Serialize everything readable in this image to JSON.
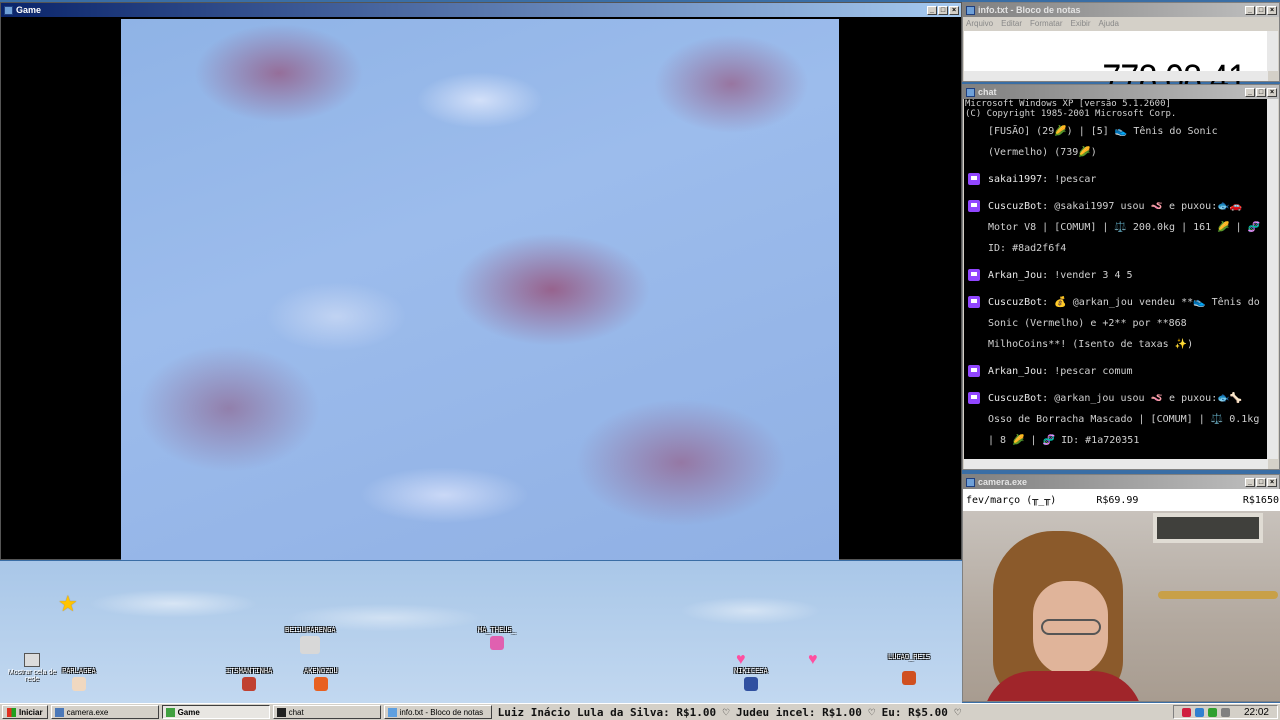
{
  "game_window": {
    "title": "Game"
  },
  "notepad": {
    "title": "info.txt - Bloco de notas",
    "menu": [
      "Arquivo",
      "Editar",
      "Formatar",
      "Exibir",
      "Ajuda"
    ],
    "timer": "778:08:41"
  },
  "chat": {
    "title": "chat",
    "header_line1": "Microsoft Windows XP [versão 5.1.2600]",
    "header_line2": "(C) Copyright 1985-2001 Microsoft Corp.",
    "messages": [
      {
        "user": "",
        "text": "[FUSÃO] (29🌽) | [5] 👟 Tênis do Sonic (Vermelho) (739🌽)"
      },
      {
        "user": "sakai1997:",
        "text": "!pescar"
      },
      {
        "user": "CuscuzBot:",
        "text": "@sakai1997 usou 🪱 e puxou:🐟🚗 Motor V8 | [COMUM] | ⚖️ 200.0kg | 161 🌽 | 🧬 ID: #8ad2f6f4"
      },
      {
        "user": "Arkan_Jou:",
        "text": "!vender 3 4 5"
      },
      {
        "user": "CuscuzBot:",
        "text": "💰 @arkan_jou vendeu **👟 Tênis do Sonic (Vermelho) e +2** por **868 MilhoCoins**! (Isento de taxas ✨)"
      },
      {
        "user": "Arkan_Jou:",
        "text": "!pescar comum"
      },
      {
        "user": "CuscuzBot:",
        "text": "@arkan_jou usou 🪱 e puxou:🐟🦴 Osso de Borracha Mascado | [COMUM] | ⚖️ 0.1kg | 8 🌽 | 🧬 ID: #1a720351"
      }
    ]
  },
  "camera": {
    "title": "camera.exe",
    "label": "fev/março (╥_╥)",
    "value1": "R$69.99",
    "value2": "R$1650"
  },
  "desktop": {
    "icon_label": "Mostrar cela de rede",
    "avatars": [
      "BEIJUPARENGA",
      "MA_THEUS_",
      "PARLAGEA",
      "ITSMANTINHA",
      "AKENOZOU",
      "NIKICESA",
      "LUCAO_REIS"
    ]
  },
  "taskbar": {
    "start": "Iniciar",
    "tasks": [
      "camera.exe",
      "Game",
      "chat",
      "info.txt - Bloco de notas"
    ],
    "ticker": "Luiz Inácio Lula da Silva: R$1.00 ♡  Judeu incel: R$1.00 ♡  Eu: R$5.00 ♡",
    "clock": "22:02"
  }
}
